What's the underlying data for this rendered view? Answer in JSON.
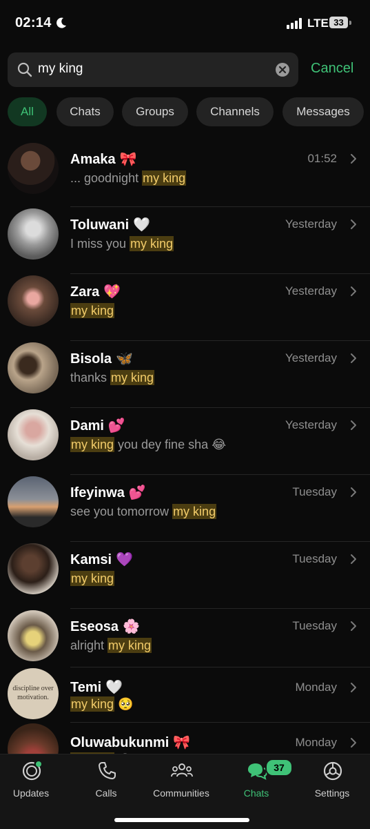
{
  "status_bar": {
    "time": "02:14",
    "network": "LTE",
    "battery": "33"
  },
  "search": {
    "query": "my king",
    "cancel_label": "Cancel"
  },
  "filters": [
    "All",
    "Chats",
    "Groups",
    "Channels",
    "Messages"
  ],
  "chats": [
    {
      "name": "Amaka",
      "emoji": "🎀",
      "time": "01:52",
      "pre": "... goodnight ",
      "match": "my king",
      "post": ""
    },
    {
      "name": "Toluwani",
      "emoji": "🤍",
      "time": "Yesterday",
      "pre": "I miss you ",
      "match": "my king",
      "post": ""
    },
    {
      "name": "Zara",
      "emoji": "💖",
      "time": "Yesterday",
      "pre": "",
      "match": "my king",
      "post": ""
    },
    {
      "name": "Bisola",
      "emoji": "🦋",
      "time": "Yesterday",
      "pre": "thanks ",
      "match": "my king",
      "post": ""
    },
    {
      "name": "Dami",
      "emoji": "💕",
      "time": "Yesterday",
      "pre": "",
      "match": "my king",
      "post": " you dey fine sha 😂"
    },
    {
      "name": "Ifeyinwa",
      "emoji": "💕",
      "time": "Tuesday",
      "pre": "see you tomorrow ",
      "match": "my king",
      "post": ""
    },
    {
      "name": "Kamsi",
      "emoji": "💜",
      "time": "Tuesday",
      "pre": "",
      "match": "my king",
      "post": ""
    },
    {
      "name": "Eseosa",
      "emoji": "🌸",
      "time": "Tuesday",
      "pre": "alright ",
      "match": "my king",
      "post": ""
    },
    {
      "name": "Temi",
      "emoji": "🤍",
      "time": "Monday",
      "pre": "",
      "match": "my king",
      "post": " 🥺",
      "avatar_text": "discipline over motivation."
    },
    {
      "name": "Oluwabukunmi",
      "emoji": "🎀",
      "time": "Monday",
      "pre": "",
      "match": "my king",
      "post": " 😂"
    }
  ],
  "tabs": [
    {
      "label": "Updates",
      "icon": "updates-icon"
    },
    {
      "label": "Calls",
      "icon": "phone-icon"
    },
    {
      "label": "Communities",
      "icon": "communities-icon"
    },
    {
      "label": "Chats",
      "icon": "chats-icon",
      "badge": "37",
      "active": true
    },
    {
      "label": "Settings",
      "icon": "gear-icon"
    }
  ],
  "colors": {
    "accent": "#3fc277",
    "highlight_bg": "#4b3d11",
    "highlight_text": "#f2cc6a",
    "background": "#0b0b0b"
  }
}
